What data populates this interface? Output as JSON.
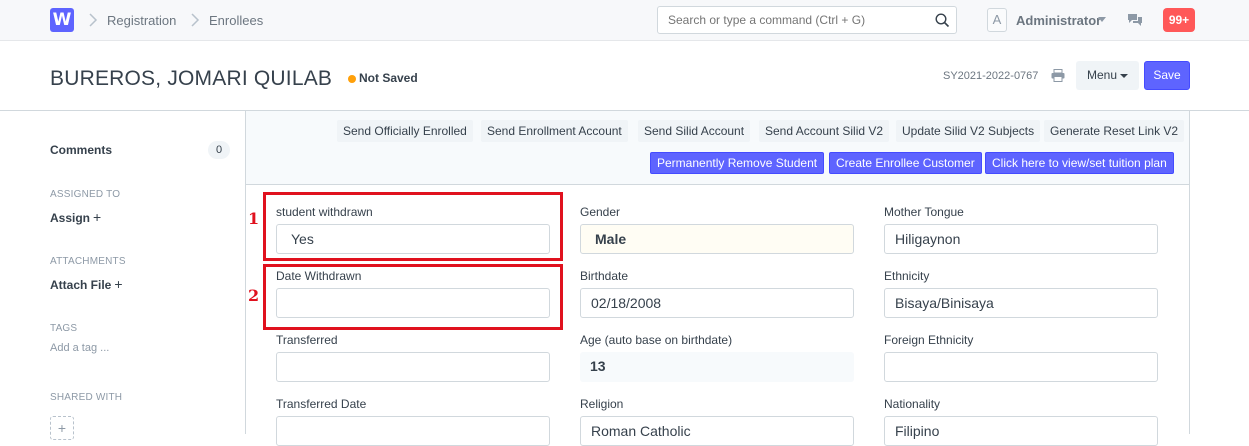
{
  "navbar": {
    "logo_letter": "W",
    "breadcrumbs": [
      "Registration",
      "Enrollees"
    ],
    "search_placeholder": "Search or type a command (Ctrl + G)",
    "avatar_letter": "A",
    "user_name": "Administrator",
    "notification_count": "99+"
  },
  "page": {
    "title": "BUREROS, JOMARI QUILAB",
    "status": "Not Saved",
    "doc_name": "SY2021-2022-0767",
    "menu_label": "Menu",
    "save_label": "Save",
    "colors": {
      "primary": "#5e64ff",
      "indicator": "#ffa00a",
      "highlight": "#e0111e"
    }
  },
  "sidebar": {
    "comments_label": "Comments",
    "comments_count": "0",
    "assigned_to_label": "ASSIGNED TO",
    "assign_action": "Assign",
    "attachments_label": "ATTACHMENTS",
    "attach_action": "Attach File",
    "tags_label": "TAGS",
    "add_tag": "Add a tag ...",
    "shared_with_label": "SHARED WITH",
    "share_icon": "plus-icon"
  },
  "actions": {
    "row1": [
      "Send Officially Enrolled",
      "Send Enrollment Account",
      "Send Silid Account",
      "Send Account Silid V2",
      "Update Silid V2 Subjects",
      "Generate Reset Link V2"
    ],
    "row2": [
      "Permanently Remove Student",
      "Create Enrollee Customer",
      "Click here to view/set tuition plan"
    ]
  },
  "fields": {
    "col1": [
      {
        "label": "student withdrawn",
        "value": "Yes"
      },
      {
        "label": "Date Withdrawn",
        "value": ""
      },
      {
        "label": "Transferred",
        "value": ""
      },
      {
        "label": "Transferred Date",
        "value": ""
      }
    ],
    "col2": [
      {
        "label": "Gender",
        "value": "Male"
      },
      {
        "label": "Birthdate",
        "value": "02/18/2008"
      },
      {
        "label": "Age (auto base on birthdate)",
        "value": "13"
      },
      {
        "label": "Religion",
        "value": "Roman Catholic"
      }
    ],
    "col3": [
      {
        "label": "Mother Tongue",
        "value": "Hiligaynon"
      },
      {
        "label": "Ethnicity",
        "value": "Bisaya/Binisaya"
      },
      {
        "label": "Foreign Ethnicity",
        "value": ""
      },
      {
        "label": "Nationality",
        "value": "Filipino"
      }
    ]
  },
  "annotations": [
    "1",
    "2"
  ]
}
